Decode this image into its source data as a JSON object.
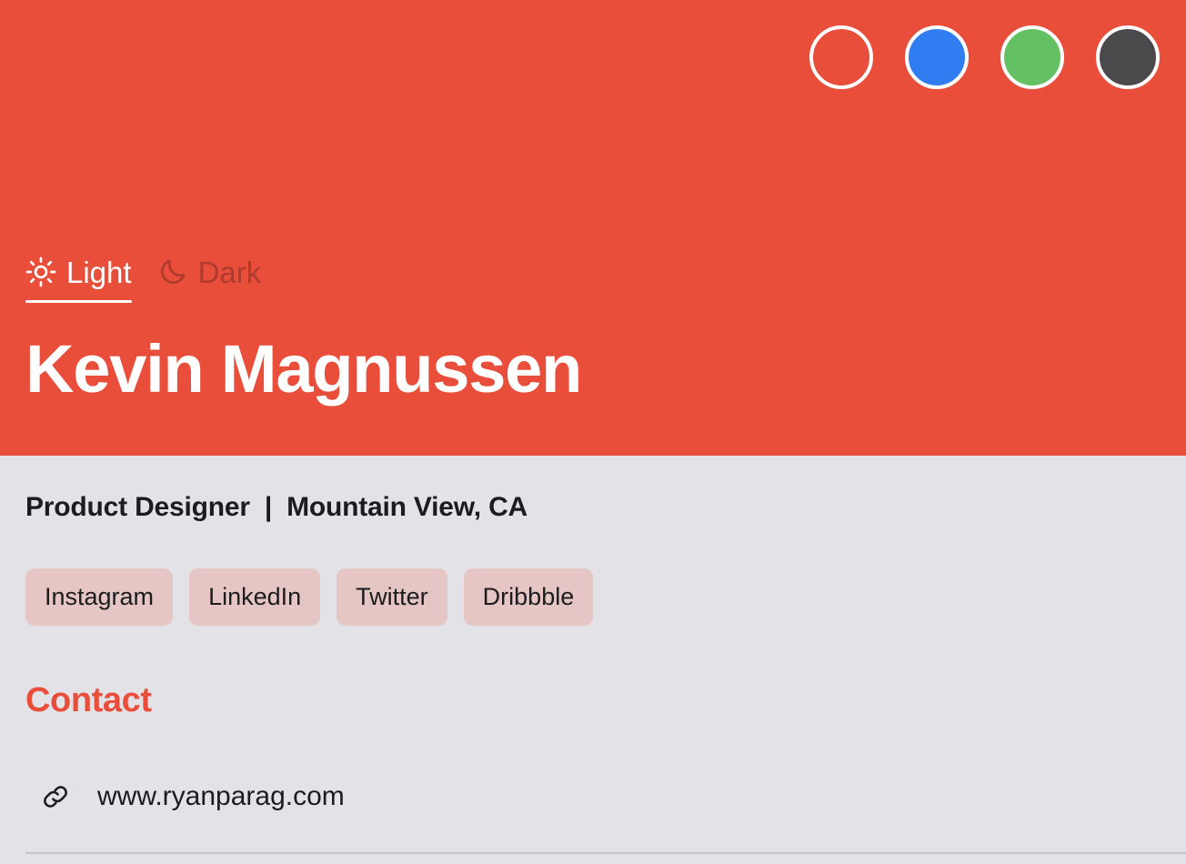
{
  "hero": {
    "background_color": "#e94e3b",
    "name": "Kevin Magnussen",
    "swatches": [
      {
        "name": "swatch-red",
        "label": "Red",
        "color": "transparent",
        "selected": true
      },
      {
        "name": "swatch-blue",
        "label": "Blue",
        "color": "#2f7df0",
        "selected": false
      },
      {
        "name": "swatch-green",
        "label": "Green",
        "color": "#63c163",
        "selected": false
      },
      {
        "name": "swatch-dark",
        "label": "Dark",
        "color": "#4a4a4c",
        "selected": false
      }
    ],
    "theme_toggle": {
      "options": [
        {
          "label": "Light",
          "icon": "sun-icon",
          "active": true
        },
        {
          "label": "Dark",
          "icon": "moon-icon",
          "active": false
        }
      ],
      "active_color": "#ffffff",
      "inactive_color": "#ae3b2d"
    }
  },
  "profile": {
    "role": "Product Designer",
    "separator": "|",
    "location": "Mountain View, CA",
    "tags": [
      {
        "label": "Instagram"
      },
      {
        "label": "LinkedIn"
      },
      {
        "label": "Twitter"
      },
      {
        "label": "Dribbble"
      }
    ],
    "tag_background": "#e5c6c4"
  },
  "contact": {
    "heading": "Contact",
    "heading_color": "#e94e3b",
    "items": [
      {
        "icon": "link-icon",
        "label": "www.ryanparag.com"
      }
    ]
  },
  "page": {
    "background_color": "#e3e3e7"
  }
}
